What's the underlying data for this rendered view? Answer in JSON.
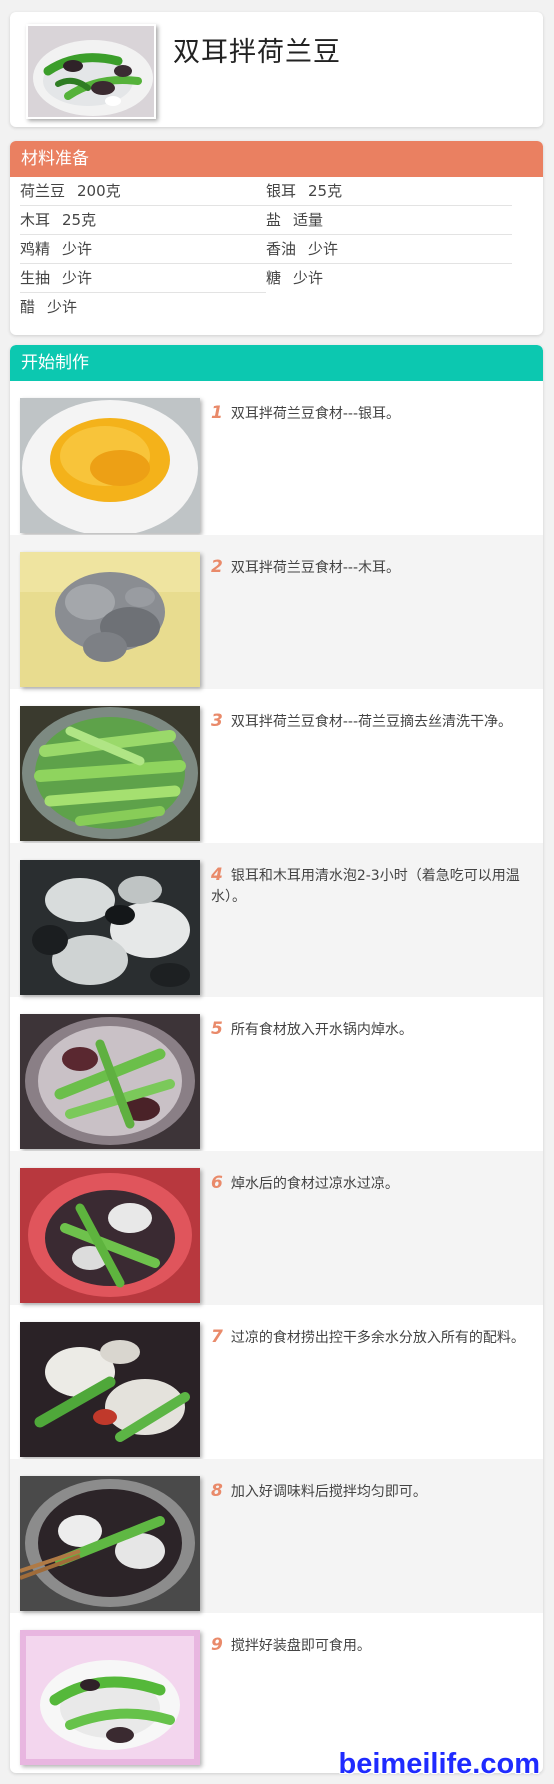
{
  "recipe": {
    "title": "双耳拌荷兰豆"
  },
  "ingredients": {
    "heading": "材料准备",
    "header_color": "#ea8061",
    "items": [
      {
        "name": "荷兰豆",
        "qty": "200克"
      },
      {
        "name": "银耳",
        "qty": "25克"
      },
      {
        "name": "木耳",
        "qty": "25克"
      },
      {
        "name": "盐",
        "qty": "适量"
      },
      {
        "name": "鸡精",
        "qty": "少许"
      },
      {
        "name": "香油",
        "qty": "少许"
      },
      {
        "name": "生抽",
        "qty": "少许"
      },
      {
        "name": "糖",
        "qty": "少许"
      },
      {
        "name": "醋",
        "qty": "少许"
      }
    ]
  },
  "steps": {
    "heading": "开始制作",
    "header_color": "#0cc8b0",
    "number_color": "#e98a6a",
    "items": [
      {
        "num": "1",
        "text": "双耳拌荷兰豆食材---银耳。"
      },
      {
        "num": "2",
        "text": "双耳拌荷兰豆食材---木耳。"
      },
      {
        "num": "3",
        "text": "双耳拌荷兰豆食材---荷兰豆摘去丝清洗干净。"
      },
      {
        "num": "4",
        "text": "银耳和木耳用清水泡2-3小时（着急吃可以用温水）。"
      },
      {
        "num": "5",
        "text": "所有食材放入开水锅内焯水。"
      },
      {
        "num": "6",
        "text": "焯水后的食材过凉水过凉。"
      },
      {
        "num": "7",
        "text": "过凉的食材捞出控干多余水分放入所有的配料。"
      },
      {
        "num": "8",
        "text": "加入好调味料后搅拌均匀即可。"
      },
      {
        "num": "9",
        "text": "搅拌好装盘即可食用。"
      }
    ]
  },
  "watermark": "beimeilife.com"
}
